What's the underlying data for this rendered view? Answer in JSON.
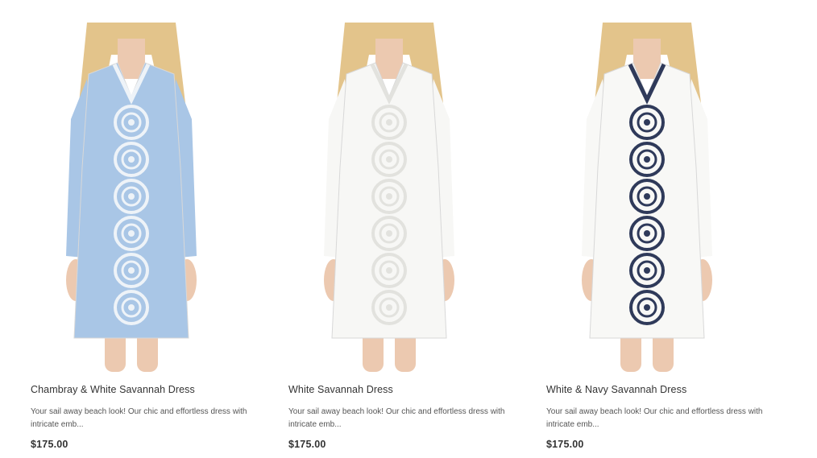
{
  "products": [
    {
      "name": "Chambray & White Savannah Dress",
      "description": "Your sail away beach look!  Our chic and effortless dress with intricate emb...",
      "price": "$175.00",
      "dress_color": "#a9c6e6",
      "embroidery_color": "#eef3f8"
    },
    {
      "name": "White Savannah Dress",
      "description": "Your sail away beach look!  Our chic and effortless dress with intricate emb...",
      "price": "$175.00",
      "dress_color": "#f7f7f5",
      "embroidery_color": "#e2e2de"
    },
    {
      "name": "White & Navy Savannah Dress",
      "description": "Your sail away beach look!  Our chic and effortless dress with intricate emb...",
      "price": "$175.00",
      "dress_color": "#f8f8f6",
      "embroidery_color": "#2f3a5a"
    }
  ],
  "colors": {
    "skin": "#ecc9b0",
    "hair": "#e3c48b",
    "background": "#ffffff"
  }
}
